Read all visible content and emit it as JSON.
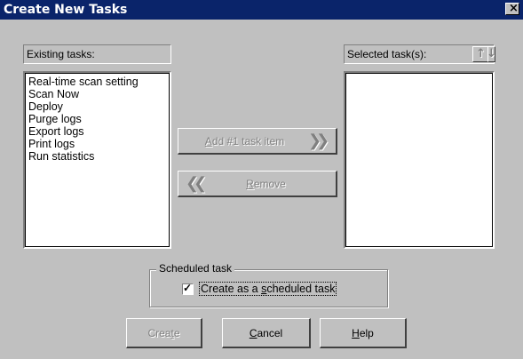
{
  "window": {
    "title": "Create New Tasks",
    "close_glyph": "×"
  },
  "existing": {
    "label": "Existing tasks:",
    "items": [
      "Real-time scan setting",
      "Scan Now",
      "Deploy",
      "Purge logs",
      "Export logs",
      "Print logs",
      "Run statistics"
    ]
  },
  "selected": {
    "label": "Selected task(s):",
    "items": []
  },
  "move_up_icon": "arrow-up-icon",
  "move_down_icon": "arrow-down-icon",
  "add_button": {
    "prefix": "A",
    "rest": "dd  #1  task item",
    "arrow": "❯❯",
    "enabled": false
  },
  "remove_button": {
    "prefix": "R",
    "rest": "emove",
    "arrow": "❮❮",
    "enabled": false
  },
  "scheduled": {
    "legend": "Scheduled task",
    "checkbox_label_pre": "Create as a ",
    "checkbox_label_u": "s",
    "checkbox_label_post": "cheduled task",
    "checked": true,
    "check_glyph": "✓"
  },
  "footer": {
    "create": {
      "pre": "Crea",
      "u": "t",
      "post": "e",
      "enabled": false
    },
    "cancel": {
      "u": "C",
      "post": "ancel"
    },
    "help": {
      "u": "H",
      "post": "elp"
    }
  },
  "colors": {
    "titlebar": "#0a246a",
    "face": "#c0c0c0"
  }
}
